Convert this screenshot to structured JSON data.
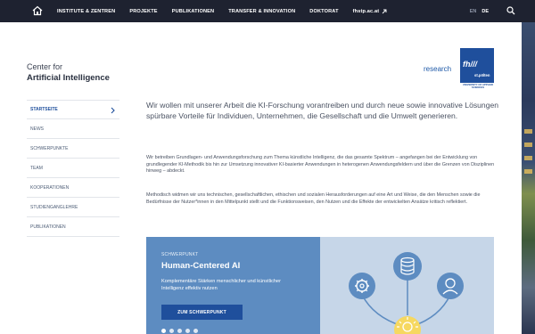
{
  "nav": {
    "items": [
      {
        "label": "INSTITUTE & ZENTREN"
      },
      {
        "label": "PROJEKTE"
      },
      {
        "label": "PUBLIKATIONEN"
      },
      {
        "label": "TRANSFER & INNOVATION"
      },
      {
        "label": "DOKTORAT"
      },
      {
        "label": "fhstp.ac.at",
        "icon": "external-link-icon"
      }
    ],
    "languages": {
      "en": "EN",
      "de": "DE",
      "active": "DE"
    },
    "icons": [
      "home-icon",
      "search-icon"
    ]
  },
  "header": {
    "center_for": "Center for",
    "center_name": "Artificial Intelligence",
    "research_label": "research",
    "logo": {
      "main": "fh///",
      "city": "st.pölten",
      "sub": "UNIVERSITY OF APPLIED SCIENCES"
    }
  },
  "sidenav": {
    "items": [
      {
        "label": "STARTSEITE",
        "active": true
      },
      {
        "label": "NEWS"
      },
      {
        "label": "SCHWERPUNKTE"
      },
      {
        "label": "TEAM"
      },
      {
        "label": "KOOPERATIONEN"
      },
      {
        "label": "STUDIENGANGLEHRE"
      },
      {
        "label": "PUBLIKATIONEN"
      }
    ]
  },
  "main": {
    "lead": "Wir wollen mit unserer Arbeit die KI-Forschung vorantreiben und durch neue sowie innovative Lösungen spürbare Vorteile für Individuen, Unternehmen, die Gesellschaft und die Umwelt generieren.",
    "paragraph_1": "Wir betreiben Grundlagen- und Anwendungsforschung zum Thema künstliche Intelligenz, die das gesamte Spektrum – angefangen bei der Entwicklung von grundlegender KI-Methodik bis hin zur Umsetzung innovativer KI-basierter Anwendungen in heterogenen Anwendungsfeldern und über die Grenzen von Disziplinen hinweg – abdeckt.",
    "paragraph_2": "Methodisch widmen wir uns technischen, gesellschaftlichen, ethischen und sozialen Herausforderungen auf eine Art und Weise, die den Menschen sowie die Bedürfnisse der Nutzer*innen in den Mittelpunkt stellt und die Funktionsweisen, den Nutzen und die Effekte der entwickelten Ansätze kritisch reflektiert."
  },
  "teaser": {
    "kicker": "SCHWERPUNKT",
    "title": "Human-Centered AI",
    "description": "Komplementäre Stärken menschlicher und künstlicher Intelligenz effektiv nutzen",
    "button": "ZUM SCHWERPUNKT",
    "slides": 5,
    "active_slide": 1,
    "illustration_icons": [
      "gear-icon",
      "database-icon",
      "user-icon",
      "lightbulb-icon"
    ]
  },
  "colors": {
    "topbar": "#1e2230",
    "brand_blue": "#1f4f9c",
    "teaser_blue": "#5d8cc1",
    "teaser_light": "#c6d6e8"
  }
}
